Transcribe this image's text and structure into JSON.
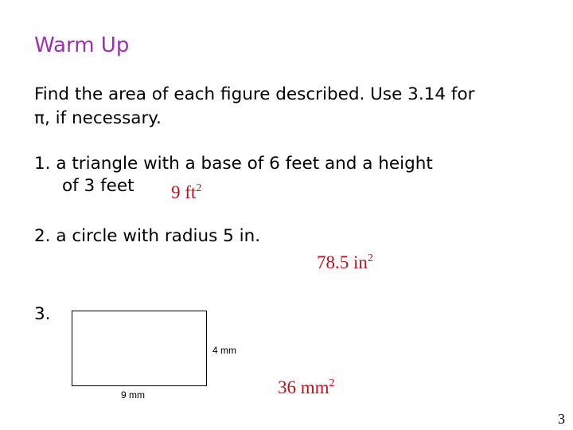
{
  "slide": {
    "title": "Warm Up",
    "instructions": {
      "line1": "Find the area of each figure described. Use 3.14 for",
      "line2": "π, if necessary."
    },
    "problems": [
      {
        "number": "1.",
        "text_line1": "1. a triangle with a base of 6 feet and a height",
        "text_line2": "of 3 feet",
        "answer_value": "9 ft",
        "answer_exponent": "2"
      },
      {
        "number": "2.",
        "text": "2. a circle with radius 5 in.",
        "answer_value": "78.5 in",
        "answer_exponent": "2"
      },
      {
        "number": "3.",
        "label": "3.",
        "figure": {
          "shape": "rectangle",
          "height_label": "4 mm",
          "width_label": "9 mm"
        },
        "answer_value": "36 mm",
        "answer_exponent": "2"
      }
    ],
    "page_number": "3",
    "colors": {
      "title": "#9933aa",
      "answer": "#b5121b",
      "text": "#000000"
    }
  }
}
